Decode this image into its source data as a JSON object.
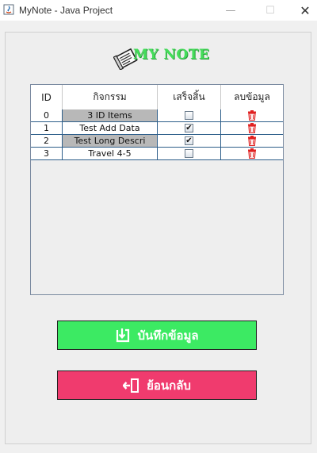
{
  "window": {
    "title": "MyNote - Java Project",
    "minimize": "—",
    "maximize": "☐",
    "close": "✕"
  },
  "header": {
    "title": "MY NOTE"
  },
  "table": {
    "columns": [
      "ID",
      "กิจกรรม",
      "เสร็จสิ้น",
      "ลบข้อมูล"
    ],
    "rows": [
      {
        "id": "0",
        "activity": "3 ID Items",
        "done": false,
        "selected": true
      },
      {
        "id": "1",
        "activity": "Test Add Data",
        "done": true,
        "selected": false
      },
      {
        "id": "2",
        "activity": "Test Long Descri",
        "done": true,
        "selected": true
      },
      {
        "id": "3",
        "activity": "Travel 4-5",
        "done": false,
        "selected": false
      }
    ]
  },
  "buttons": {
    "save_label": "บันทึกข้อมูล",
    "back_label": "ย้อนกลับ"
  },
  "colors": {
    "save_button": "#3cea63",
    "back_button": "#f03b6e",
    "title_green": "#44dd5a",
    "delete_icon": "#e02020"
  }
}
